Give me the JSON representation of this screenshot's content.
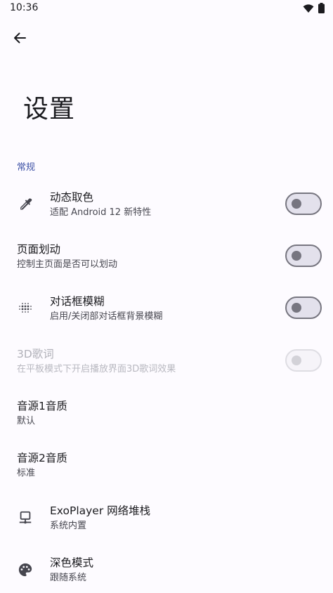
{
  "status_bar": {
    "time": "10:36"
  },
  "header": {
    "title": "设置"
  },
  "section": {
    "label": "常规"
  },
  "settings": [
    {
      "title": "动态取色",
      "subtitle": "适配 Android 12 新特性",
      "icon": "eyedropper-icon",
      "toggle": false,
      "enabled": true
    },
    {
      "title": "页面划动",
      "subtitle": "控制主页面是否可以划动",
      "icon": null,
      "toggle": false,
      "enabled": true
    },
    {
      "title": "对话框模糊",
      "subtitle": "启用/关闭部对话框背景模糊",
      "icon": "blur-icon",
      "toggle": false,
      "enabled": true
    },
    {
      "title": "3D歌词",
      "subtitle": "在平板模式下开启播放界面3D歌词效果",
      "icon": null,
      "toggle": false,
      "enabled": false
    },
    {
      "title": "音源1音质",
      "subtitle": "默认",
      "icon": null
    },
    {
      "title": "音源2音质",
      "subtitle": "标准",
      "icon": null
    },
    {
      "title": "ExoPlayer 网络堆栈",
      "subtitle": "系统内置",
      "icon": "network-icon"
    },
    {
      "title": "深色模式",
      "subtitle": "跟随系统",
      "icon": "palette-icon"
    }
  ],
  "colors": {
    "background": "#fdfbff",
    "accent": "#3d51a6",
    "switch_outline": "#777680"
  }
}
